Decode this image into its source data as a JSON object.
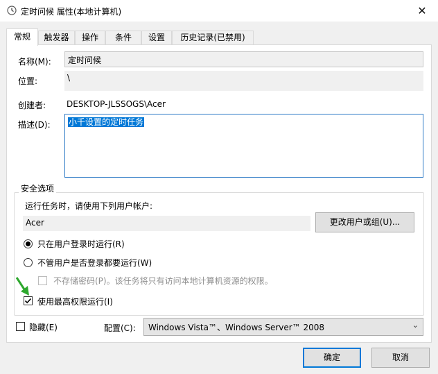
{
  "window": {
    "title": "定时问候 属性(本地计算机)",
    "close": "✕"
  },
  "tabs": [
    {
      "label": "常规"
    },
    {
      "label": "触发器"
    },
    {
      "label": "操作"
    },
    {
      "label": "条件"
    },
    {
      "label": "设置"
    },
    {
      "label": "历史记录(已禁用)"
    }
  ],
  "general": {
    "name_label": "名称(M):",
    "name_value": "定时问候",
    "location_label": "位置:",
    "location_value": "\\",
    "author_label": "创建者:",
    "author_value": "DESKTOP-JLSSOGS\\Acer",
    "description_label": "描述(D):",
    "description_value": "小千设置的定时任务"
  },
  "security": {
    "group_title": "安全选项",
    "run_as_label": "运行任务时，请使用下列用户帐户:",
    "user_value": "Acer",
    "change_user_button": "更改用户或组(U)...",
    "radio_logged_on": "只在用户登录时运行(R)",
    "radio_logged_on_checked": true,
    "radio_whether": "不管用户是否登录都要运行(W)",
    "radio_whether_checked": false,
    "no_store_password": "不存储密码(P)。该任务将只有访问本地计算机资源的权限。",
    "highest_privileges": "使用最高权限运行(I)",
    "highest_privileges_checked": true
  },
  "bottom": {
    "hidden_label": "隐藏(E)",
    "hidden_checked": false,
    "configure_label": "配置(C):",
    "configure_value": "Windows Vista™、Windows Server™ 2008"
  },
  "buttons": {
    "ok": "确定",
    "cancel": "取消"
  },
  "colors": {
    "accent": "#0078d7",
    "annotation_arrow": "#2ea82e"
  }
}
